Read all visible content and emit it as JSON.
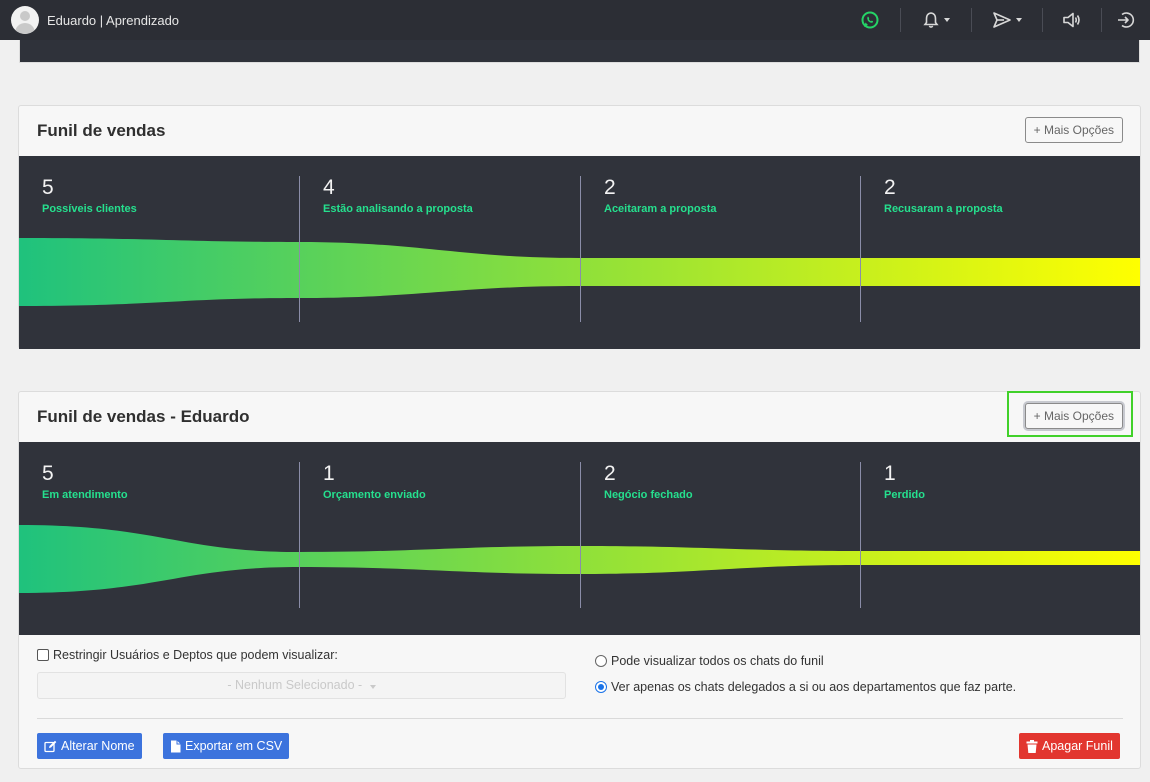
{
  "topbar": {
    "title": "Eduardo | Aprendizado",
    "icons": [
      "whatsapp-icon",
      "bell-icon",
      "send-icon",
      "speaker-icon",
      "logout-icon"
    ],
    "colors": {
      "background": "#2c2e35",
      "whatsapp": "#25d366"
    }
  },
  "funnels": [
    {
      "title": "Funil de vendas",
      "options_label": "+ Mais Opções",
      "stages": [
        {
          "count": "5",
          "label": "Possíveis clientes"
        },
        {
          "count": "4",
          "label": "Estão analisando a proposta"
        },
        {
          "count": "2",
          "label": "Aceitaram a proposta"
        },
        {
          "count": "2",
          "label": "Recusaram a proposta"
        }
      ]
    },
    {
      "title": "Funil de vendas - Eduardo",
      "options_label": "+ Mais Opções",
      "stages": [
        {
          "count": "5",
          "label": "Em atendimento"
        },
        {
          "count": "1",
          "label": "Orçamento enviado"
        },
        {
          "count": "2",
          "label": "Negócio fechado"
        },
        {
          "count": "1",
          "label": "Perdido"
        }
      ],
      "settings": {
        "restrict_label": "Restringir Usuários e Deptos que podem visualizar:",
        "restrict_checked": false,
        "select_placeholder": "- Nenhum Selecionado -",
        "radio_all": "Pode visualizar todos os chats do funil",
        "radio_delegated": "Ver apenas os chats delegados a si ou aos departamentos que faz parte.",
        "selected_radio": "delegated"
      },
      "buttons": {
        "rename": "Alterar Nome",
        "export": "Exportar em CSV",
        "delete": "Apagar Funil"
      }
    }
  ],
  "colors": {
    "funnel_bg": "#30333b",
    "gradient_start": "#1fc27d",
    "gradient_end": "#ffff00",
    "stage_label": "#25e08e",
    "primary_button": "#3c73dd",
    "danger_button": "#e2362f"
  }
}
